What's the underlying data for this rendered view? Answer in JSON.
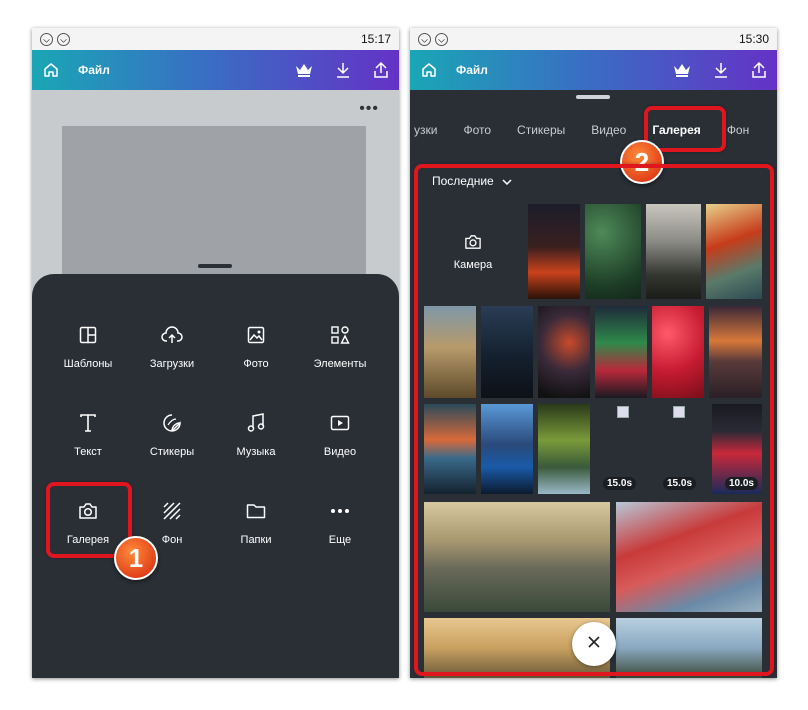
{
  "left": {
    "status_time": "15:17",
    "file_label": "Файл",
    "menu_dots": "•••",
    "grid": [
      {
        "label": "Шаблоны",
        "icon": "templates-icon"
      },
      {
        "label": "Загрузки",
        "icon": "upload-cloud-icon"
      },
      {
        "label": "Фото",
        "icon": "photo-icon"
      },
      {
        "label": "Элементы",
        "icon": "elements-icon"
      },
      {
        "label": "Текст",
        "icon": "text-icon"
      },
      {
        "label": "Стикеры",
        "icon": "sticker-icon"
      },
      {
        "label": "Музыка",
        "icon": "music-icon"
      },
      {
        "label": "Видео",
        "icon": "video-icon"
      },
      {
        "label": "Галерея",
        "icon": "camera-icon"
      },
      {
        "label": "Фон",
        "icon": "background-icon"
      },
      {
        "label": "Папки",
        "icon": "folder-icon"
      },
      {
        "label": "Еще",
        "icon": "more-icon"
      }
    ],
    "step_badge": "1"
  },
  "right": {
    "status_time": "15:30",
    "tabs": [
      "узки",
      "Фото",
      "Стикеры",
      "Видео",
      "Галерея",
      "Фон"
    ],
    "active_tab": "Галерея",
    "filter_label": "Последние",
    "camera_label": "Камера",
    "durations": [
      "15.0s",
      "15.0s",
      "10.0s"
    ],
    "step_badge": "2"
  },
  "colors": {
    "accent_red": "#e0161f",
    "badge_orange": "#e2431a",
    "panel_dark": "#2a2f36",
    "topbar_start": "#1aa6b6",
    "topbar_end": "#6532c6"
  }
}
